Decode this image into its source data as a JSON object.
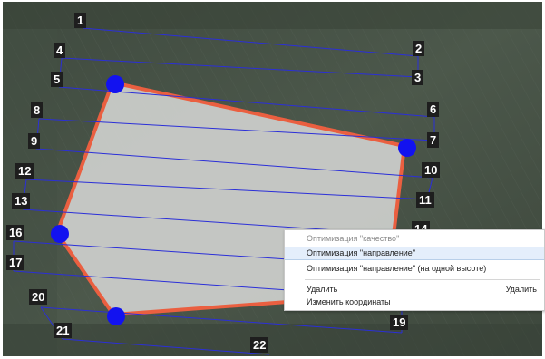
{
  "map": {
    "line_color": "#2b2fd8",
    "polygon_fill": "#c9ccca",
    "polygon_border": "#f06040",
    "vertex_color": "#1212f0",
    "waypoint_labels": [
      "1",
      "2",
      "3",
      "4",
      "5",
      "6",
      "7",
      "8",
      "9",
      "10",
      "11",
      "12",
      "13",
      "14",
      "16",
      "17",
      "19",
      "20",
      "21",
      "22"
    ]
  },
  "context_menu": {
    "items": [
      {
        "label": "Оптимизация \"качество\"",
        "state": "disabled"
      },
      {
        "label": "Оптимизация \"направление\"",
        "state": "highlighted"
      },
      {
        "label": "Оптимизация \"направление\" (на одной высоте)",
        "state": "normal"
      },
      {
        "label": "Удалить",
        "shortcut": "Удалить",
        "state": "normal"
      },
      {
        "label": "Изменить координаты",
        "state": "normal"
      }
    ]
  }
}
